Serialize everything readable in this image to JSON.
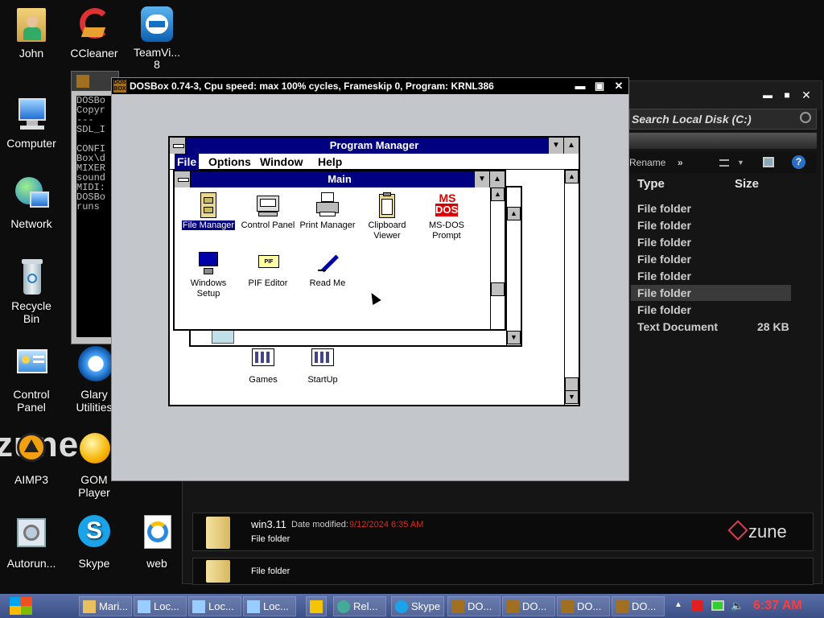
{
  "desktop": {
    "icons": [
      {
        "label": "John"
      },
      {
        "label": "CCleaner"
      },
      {
        "label": "TeamVi...\n8"
      },
      {
        "label": "Computer"
      },
      {
        "label": "Network"
      },
      {
        "label": "Recycle\nBin"
      },
      {
        "label": "Control\nPanel"
      },
      {
        "label": "Glary\nUtilities"
      },
      {
        "label": "AIMP3"
      },
      {
        "label": "GOM\nPlayer"
      },
      {
        "label": "Autorun..."
      },
      {
        "label": "Skype"
      },
      {
        "label": "web"
      }
    ],
    "zune_wallpaper_text": "zune"
  },
  "cmd_window": {
    "lines": [
      "DOSBo",
      "Copyr",
      "---",
      "SDL_I",
      "",
      "CONFI",
      "Box\\d",
      "MIXER",
      "sound",
      "MIDI:",
      "DOSBo",
      "runs"
    ]
  },
  "explorer": {
    "search_placeholder": "Search Local Disk (C:)",
    "toolbar": {
      "rename": "Rename",
      "more": "»"
    },
    "columns": {
      "type": "Type",
      "size": "Size"
    },
    "rows": [
      {
        "type": "File folder",
        "size": "",
        "selected": false
      },
      {
        "type": "File folder",
        "size": "",
        "selected": false
      },
      {
        "type": "File folder",
        "size": "",
        "selected": false
      },
      {
        "type": "File folder",
        "size": "",
        "selected": false
      },
      {
        "type": "File folder",
        "size": "",
        "selected": false
      },
      {
        "type": "File folder",
        "size": "",
        "selected": true
      },
      {
        "type": "File folder",
        "size": "",
        "selected": false
      },
      {
        "type": "Text Document",
        "size": "28 KB",
        "selected": false
      }
    ],
    "details": {
      "name": "win3.11",
      "date_label": "Date modified:",
      "date_value": "9/12/2024 6:35 AM",
      "kind": "File folder",
      "kind2": "File folder"
    },
    "brand": "zune"
  },
  "dosbox": {
    "title": "DOSBox 0.74-3, Cpu speed: max 100% cycles, Frameskip  0, Program:  KRNL386",
    "logo": "DOS BOX"
  },
  "program_manager": {
    "title": "Program Manager",
    "menu": [
      "File",
      "Options",
      "Window",
      "Help"
    ],
    "main_group": {
      "title": "Main",
      "icons": [
        {
          "label": "File Manager",
          "selected": true
        },
        {
          "label": "Control Panel",
          "selected": false
        },
        {
          "label": "Print Manager",
          "selected": false
        },
        {
          "label": "Clipboard\nViewer",
          "selected": false
        },
        {
          "label": "MS-DOS\nPrompt",
          "selected": false
        },
        {
          "label": "Windows\nSetup",
          "selected": false
        },
        {
          "label": "PIF Editor",
          "selected": false
        },
        {
          "label": "Read Me",
          "selected": false
        }
      ]
    },
    "group_icons": [
      {
        "label": "Games"
      },
      {
        "label": "StartUp"
      }
    ]
  },
  "taskbar": {
    "items": [
      {
        "label": "Mari..."
      },
      {
        "label": "Loc..."
      },
      {
        "label": "Loc..."
      },
      {
        "label": "Loc..."
      },
      {
        "label": ""
      },
      {
        "label": "Rel..."
      },
      {
        "label": "Skype"
      },
      {
        "label": "DO..."
      },
      {
        "label": "DO..."
      },
      {
        "label": "DO..."
      },
      {
        "label": "DO..."
      }
    ],
    "clock": "6:37 AM"
  },
  "colors": {
    "win31_title": "#000080",
    "clock": "#ff3b3b",
    "date_modified": "#d03020"
  }
}
